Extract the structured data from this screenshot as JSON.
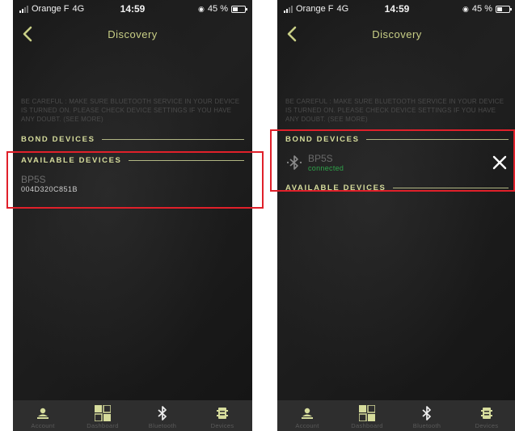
{
  "status_bar": {
    "carrier": "Orange F",
    "network": "4G",
    "time": "14:59",
    "battery": "45 %"
  },
  "nav": {
    "title": "Discovery"
  },
  "warning_text": "BE CAREFUL : MAKE SURE BLUETOOTH SERVICE IN YOUR DEVICE IS TURNED ON. PLEASE CHECK DEVICE SETTINGS IF YOU HAVE ANY DOUBT. (SEE MORE)",
  "sections": {
    "bond_devices": "BOND DEVICES",
    "available_devices": "AVAILABLE DEVICES"
  },
  "left_screen": {
    "available_device": {
      "name": "BP5S",
      "mac": "004D320C851B"
    }
  },
  "right_screen": {
    "bonded_device": {
      "name": "BP5S",
      "status": "connected"
    }
  },
  "tabs": [
    {
      "label": "Account",
      "icon": "person-icon"
    },
    {
      "label": "Dashboard",
      "icon": "dashboard-icon"
    },
    {
      "label": "Bluetooth",
      "icon": "bluetooth-icon"
    },
    {
      "label": "Devices",
      "icon": "devices-icon"
    }
  ],
  "colors": {
    "accent": "#d6dc9c",
    "connected": "#2fa34a",
    "highlight": "#e0202a",
    "background": "#161616",
    "tab_bar": "#2e2e2e"
  }
}
